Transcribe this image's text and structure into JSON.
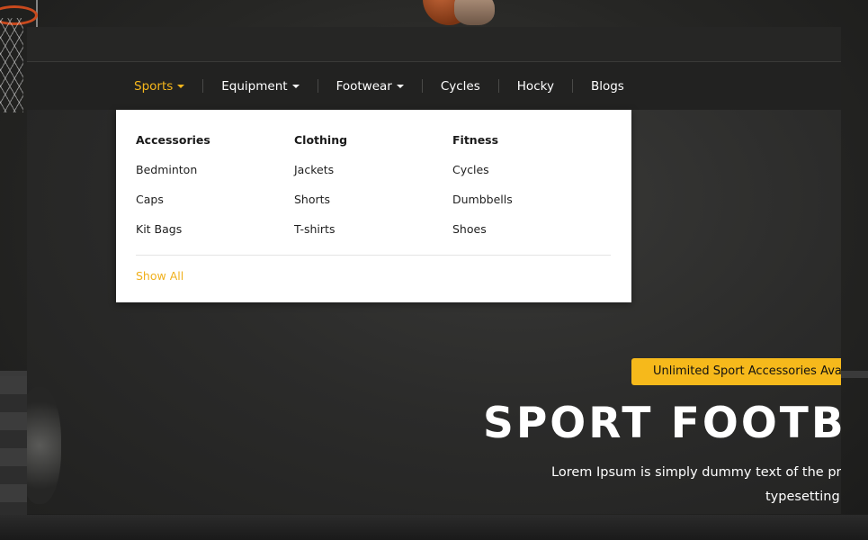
{
  "nav": {
    "items": [
      {
        "label": "Sports",
        "dropdown": true,
        "active": true
      },
      {
        "label": "Equipment",
        "dropdown": true
      },
      {
        "label": "Footwear",
        "dropdown": true
      },
      {
        "label": "Cycles"
      },
      {
        "label": "Hocky"
      },
      {
        "label": "Blogs"
      }
    ]
  },
  "mega_menu": {
    "columns": [
      {
        "title": "Accessories",
        "links": [
          "Bedminton",
          "Caps",
          "Kit Bags"
        ]
      },
      {
        "title": "Clothing",
        "links": [
          "Jackets",
          "Shorts",
          "T-shirts"
        ]
      },
      {
        "title": "Fitness",
        "links": [
          "Cycles",
          "Dumbbells",
          "Shoes"
        ]
      }
    ],
    "show_all": "Show All"
  },
  "hero": {
    "badge": "Unlimited Sport Accessories Ava",
    "title": "SPORT FOOTBA",
    "text_line1": "Lorem Ipsum is simply dummy text of the prin",
    "text_line2": "typesetting"
  },
  "colors": {
    "accent": "#f6b71c",
    "nav_bg": "#222221",
    "dropdown_bg": "#ffffff"
  }
}
